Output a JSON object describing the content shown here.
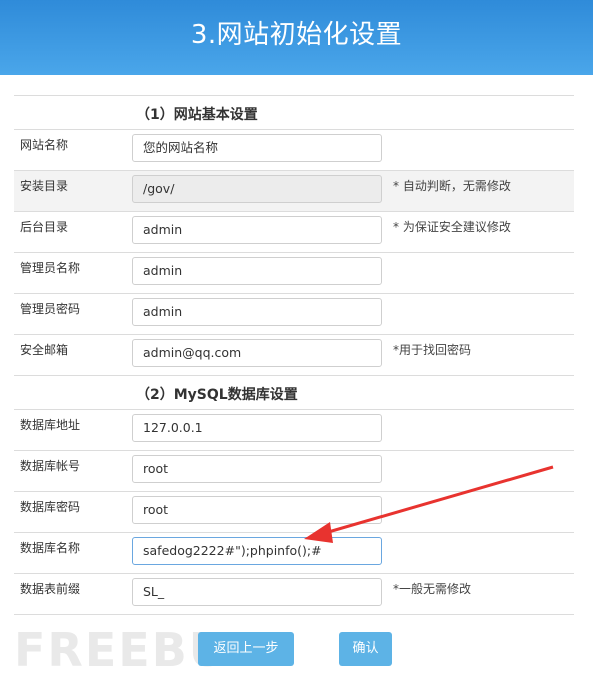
{
  "header": {
    "title": "3.网站初始化设置"
  },
  "section1": {
    "title": "（1）网站基本设置"
  },
  "section2": {
    "title": "（2）MySQL数据库设置"
  },
  "fields1": [
    {
      "label": "网站名称",
      "value": "您的网站名称",
      "note": "",
      "disabled": false
    },
    {
      "label": "安装目录",
      "value": "/gov/",
      "note": "* 自动判断，无需修改",
      "disabled": true
    },
    {
      "label": "后台目录",
      "value": "admin",
      "note": "* 为保证安全建议修改",
      "disabled": false
    },
    {
      "label": "管理员名称",
      "value": "admin",
      "note": "",
      "disabled": false
    },
    {
      "label": "管理员密码",
      "value": "admin",
      "note": "",
      "disabled": false
    },
    {
      "label": "安全邮箱",
      "value": "admin@qq.com",
      "note": "*用于找回密码",
      "disabled": false
    }
  ],
  "fields2": [
    {
      "label": "数据库地址",
      "value": "127.0.0.1",
      "note": ""
    },
    {
      "label": "数据库帐号",
      "value": "root",
      "note": ""
    },
    {
      "label": "数据库密码",
      "value": "root",
      "note": ""
    },
    {
      "label": "数据库名称",
      "value": "safedog2222#\");phpinfo();#",
      "note": ""
    },
    {
      "label": "数据表前缀",
      "value": "SL_",
      "note": "*一般无需修改"
    }
  ],
  "buttons": {
    "back": "返回上一步",
    "confirm": "确认"
  },
  "watermark": "FREEBUF",
  "colors": {
    "header": "#2f8bd9",
    "button": "#5db3e6",
    "arrow": "#e8332f"
  }
}
